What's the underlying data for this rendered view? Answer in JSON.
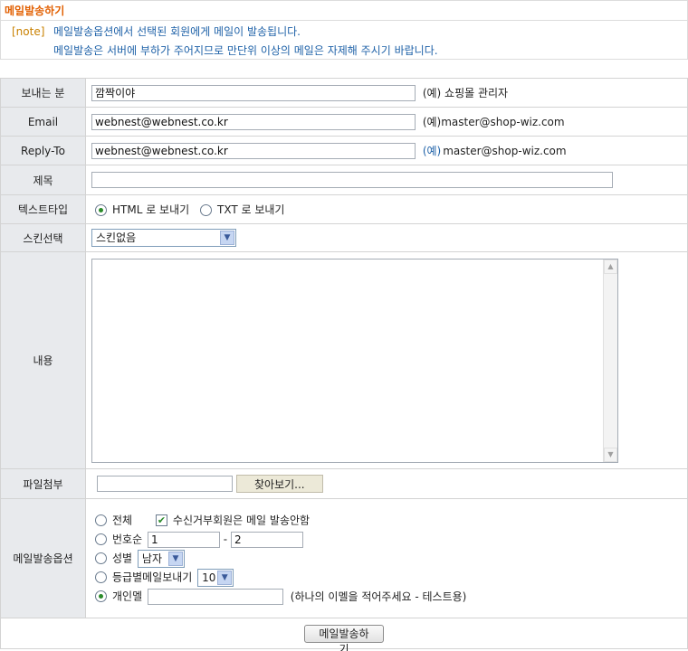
{
  "header": {
    "title": "메일발송하기",
    "note_tag": "[note]",
    "note_line1": "메일발송옵션에서 선택된 회원에게 메일이 발송됩니다.",
    "note_line2": "메일발송은 서버에 부하가 주어지므로 만단위 이상의 메일은 자제해 주시기 바랍니다."
  },
  "form": {
    "sender": {
      "label": "보내는 분",
      "value": "깜짝이야",
      "hint": "(예) 쇼핑몰 관리자"
    },
    "email": {
      "label": "Email",
      "value": "webnest@webnest.co.kr",
      "hint": "(예)master@shop-wiz.com"
    },
    "reply_to": {
      "label": "Reply-To",
      "value": "webnest@webnest.co.kr",
      "hint_prefix": "(예)",
      "hint": "master@shop-wiz.com"
    },
    "subject": {
      "label": "제목",
      "value": ""
    },
    "text_type": {
      "label": "텍스트타입",
      "option_html": "HTML 로 보내기",
      "option_txt": "TXT 로 보내기",
      "selected": "html"
    },
    "skin": {
      "label": "스킨선택",
      "selected": "스킨없음"
    },
    "content": {
      "label": "내용",
      "value": ""
    },
    "attachment": {
      "label": "파일첨부",
      "value": "",
      "browse_label": "찾아보기..."
    },
    "options": {
      "label": "메일발송옵션",
      "all_label": "전체",
      "exclude_refused_label": "수신거부회원은 메일 발송안함",
      "exclude_refused_checked": true,
      "number_range_label": "번호순",
      "range_from": "1",
      "range_dash": "-",
      "range_to": "2",
      "gender_label": "성별",
      "gender_selected": "남자",
      "grade_label": "등급별메일보내기",
      "grade_selected": "10",
      "personal_label": "개인멜",
      "personal_value": "",
      "personal_hint": "(하나의 이멜을 적어주세요 - 테스트용)",
      "selected": "personal"
    },
    "submit_label": "메일발송하기"
  }
}
